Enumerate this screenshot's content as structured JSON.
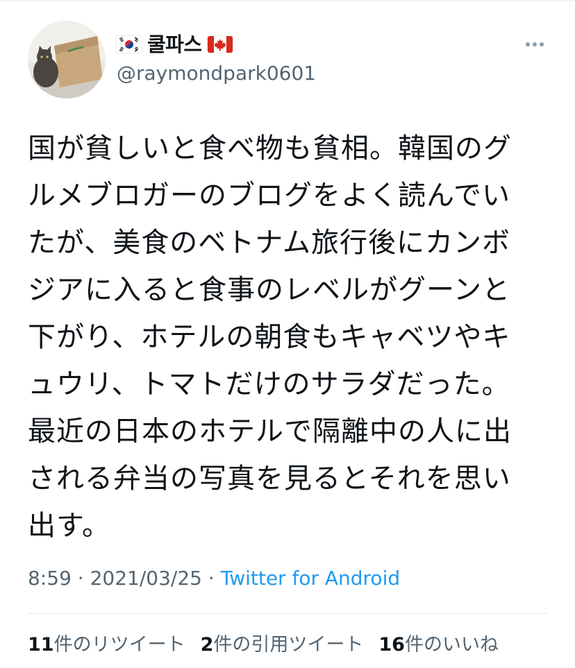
{
  "tweet": {
    "author": {
      "display_name": "쿨파스",
      "handle": "@raymondpark0601",
      "flags": [
        "south-korea-flag",
        "canada-flag"
      ]
    },
    "text_lines": [
      "国が貧しいと食べ物も貧相。韓国のグ",
      "ルメブロガーのブログをよく読んでい",
      "たが、美食のベトナム旅行後にカンボ",
      "ジアに入ると食事のレベルがグーンと",
      "下がり、ホテルの朝食もキャベツやキ",
      "ュウリ、トマトだけのサラダだった。",
      "最近の日本のホテルで隔離中の人に出",
      "される弁当の写真を見るとそれを思い",
      "出す。"
    ],
    "time": "8:59",
    "separator": "·",
    "date": "2021/03/25",
    "source": "Twitter for Android",
    "stats": {
      "retweets_count": "11",
      "retweets_label": "件のリツイート",
      "quotes_count": "2",
      "quotes_label": "件の引用ツイート",
      "likes_count": "16",
      "likes_label": "件のいいね"
    }
  },
  "icons": {
    "more": "more-horizontal-icon"
  },
  "colors": {
    "text": "#0f1419",
    "secondary": "#536471",
    "link": "#1d9bf0",
    "divider": "#e1e6ea"
  }
}
